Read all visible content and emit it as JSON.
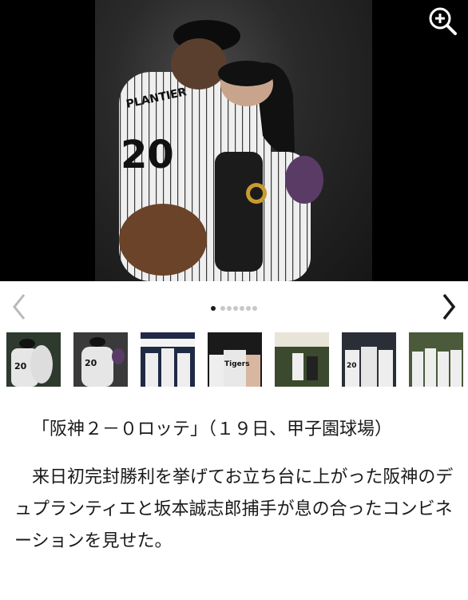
{
  "photo": {
    "jersey_name": "PLANTIER",
    "jersey_number": "20"
  },
  "gallery": {
    "zoom_icon": "zoom-in-icon",
    "prev_icon": "chevron-left-icon",
    "next_icon": "chevron-right-icon",
    "page_count": 7,
    "current_page": 1
  },
  "thumbnails": [
    {
      "label": "20"
    },
    {
      "label": "20"
    },
    {
      "label": ""
    },
    {
      "label": "Tigers"
    },
    {
      "label": ""
    },
    {
      "label": "20"
    },
    {
      "label": ""
    }
  ],
  "article": {
    "caption": "「阪神２－０ロッテ」（１９日、甲子園球場）",
    "body": "来日初完封勝利を挙げてお立ち台に上がった阪神のデュプランティエと坂本誠志郎捕手が息の合ったコンビネーションを見せた。"
  },
  "colors": {
    "photo_bg": "#000000",
    "dot_active": "#1a1a1a",
    "dot_inactive": "#c8c8c8",
    "arrow_disabled": "#b9b9b9",
    "arrow_enabled": "#1a1a1a"
  }
}
